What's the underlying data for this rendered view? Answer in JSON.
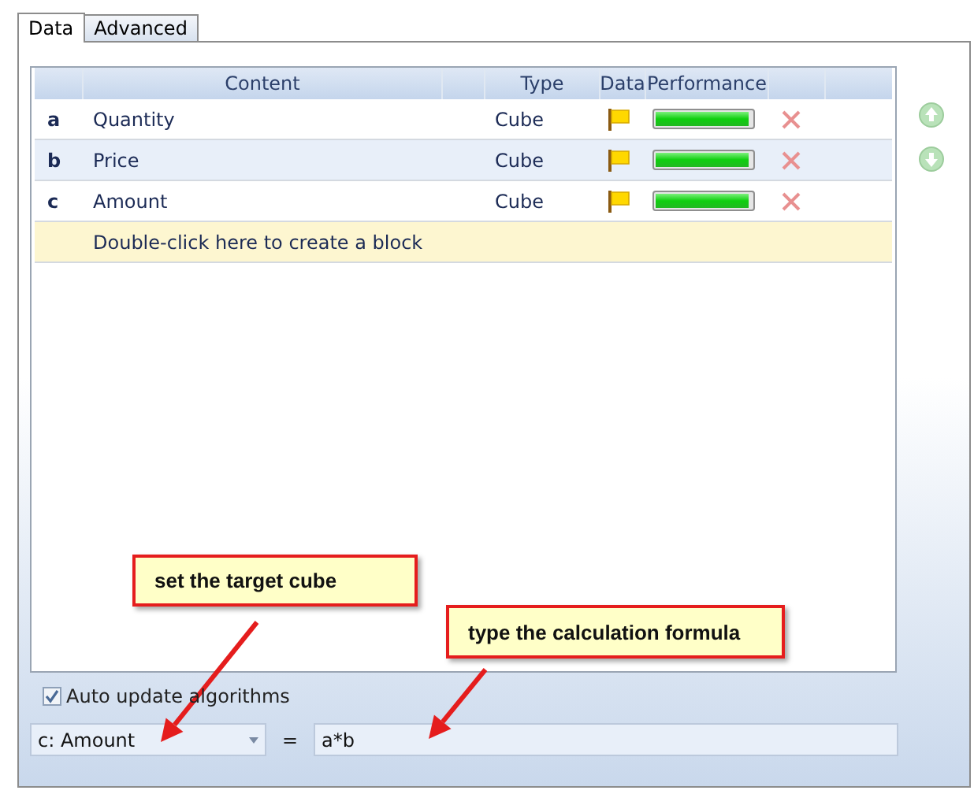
{
  "tabs": [
    {
      "label": "Data",
      "selected": true
    },
    {
      "label": "Advanced",
      "selected": false
    }
  ],
  "grid": {
    "columns": [
      "Content",
      "Type",
      "Data",
      "Performance"
    ],
    "rows": [
      {
        "letter": "a",
        "content": "Quantity",
        "type": "Cube",
        "selected": false,
        "level": 0.97
      },
      {
        "letter": "b",
        "content": "Price",
        "type": "Cube",
        "selected": true,
        "level": 0.97
      },
      {
        "letter": "c",
        "content": "Amount",
        "type": "Cube",
        "selected": false,
        "level": 0.97
      }
    ],
    "new_row_hint": "Double-click here to create a block"
  },
  "auto_update": {
    "label": "Auto update algorithms",
    "checked": true
  },
  "target_cube": {
    "value": "c: Amount"
  },
  "equals": "=",
  "formula": {
    "value": "a*b"
  },
  "callouts": [
    {
      "text": "set the target cube"
    },
    {
      "text": "type the calculation formula"
    }
  ]
}
